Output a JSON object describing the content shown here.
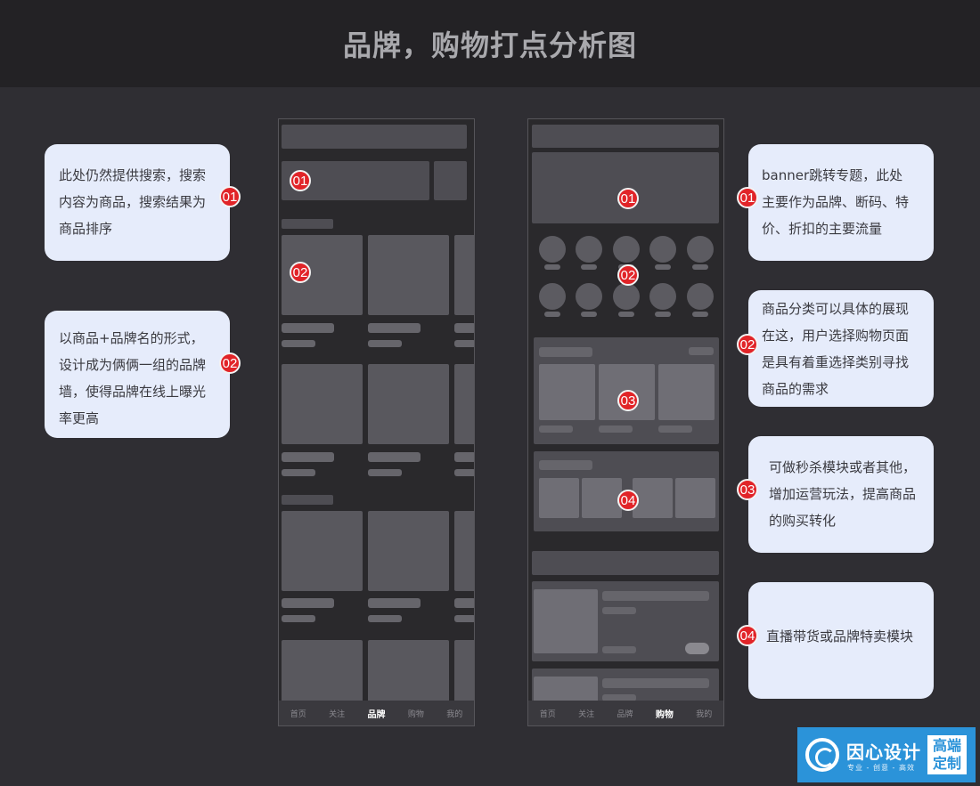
{
  "page_title": "品牌，购物打点分析图",
  "left_notes": [
    {
      "badge": "01",
      "lines": [
        "此处仍然提供搜索，搜索",
        "内容为商品，搜索结果为",
        "商品排序"
      ]
    },
    {
      "badge": "02",
      "lines": [
        "以商品+品牌名的形式，",
        "设计成为俩俩一组的品牌",
        "墙，使得品牌在线上曝光",
        "率更高"
      ]
    }
  ],
  "right_notes": [
    {
      "badge": "01",
      "lines": [
        "banner跳转专题，此处",
        "主要作为品牌、断码、特",
        "价、折扣的主要流量"
      ]
    },
    {
      "badge": "02",
      "lines": [
        "商品分类可以具体的展现",
        "在这，用户选择购物页面",
        "是具有着重选择类别寻找",
        "商品的需求"
      ]
    },
    {
      "badge": "03",
      "lines": [
        "可做秒杀模块或者其他，",
        "增加运营玩法，提高商品",
        "的购买转化"
      ]
    },
    {
      "badge": "04",
      "lines": [
        "直播带货或品牌特卖模块"
      ]
    }
  ],
  "brand_phone": {
    "markers": [
      "01",
      "02"
    ],
    "tabs": [
      "首页",
      "关注",
      "品牌",
      "购物",
      "我的"
    ],
    "active_tab": "品牌"
  },
  "shop_phone": {
    "markers": [
      "01",
      "02",
      "03",
      "04"
    ],
    "tabs": [
      "首页",
      "关注",
      "品牌",
      "购物",
      "我的"
    ],
    "active_tab": "购物"
  },
  "logo": {
    "brand": "因心设计",
    "tagline": "专业 - 创意 - 高效",
    "box_line1": "高端",
    "box_line2": "定制"
  },
  "colors": {
    "badge": "#e12428",
    "note_bg": "#e6ecfb",
    "logo_bg": "#2b93d9"
  }
}
